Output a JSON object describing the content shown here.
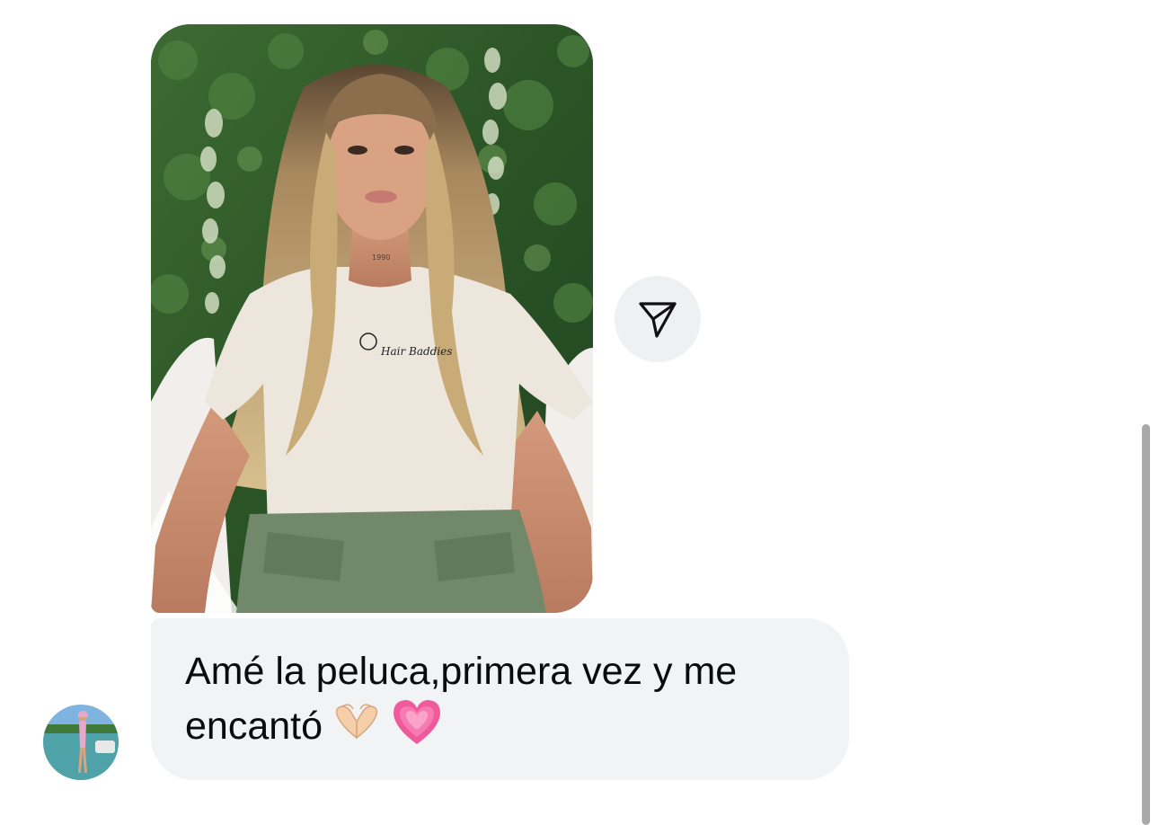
{
  "messages": [
    {
      "type": "shared_photo",
      "image_description": "",
      "shirt_print": "Hair Baddies",
      "neck_tattoo": "1990"
    },
    {
      "type": "text",
      "text": "Amé la peluca,primera vez y me encantó",
      "emojis": [
        "heart-hands-emoji",
        "growing-heart-emoji"
      ]
    }
  ],
  "icons": {
    "share": "send-paper-plane-icon"
  },
  "colors": {
    "bubble_bg": "#f2f3f5",
    "share_btn_bg": "#eff0f2",
    "text": "#0b0b0b",
    "scrollbar": "#a9a9a9"
  }
}
